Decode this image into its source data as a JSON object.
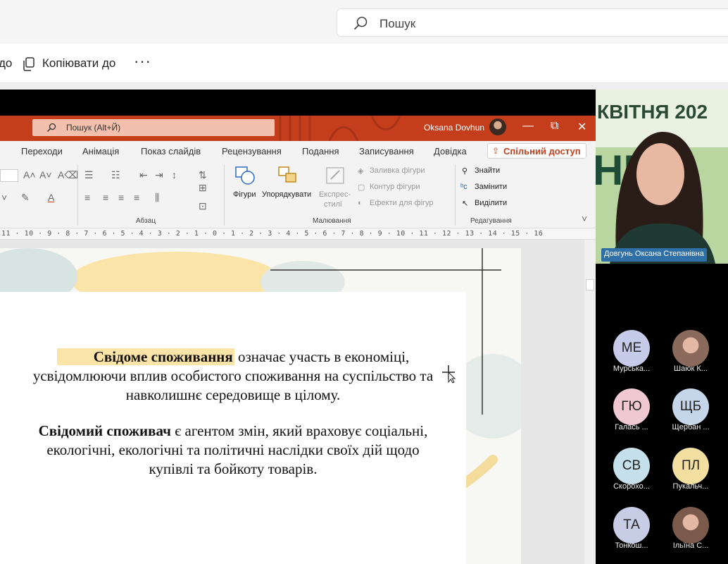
{
  "teams": {
    "search_placeholder": "Пошук",
    "cmd_left": "до",
    "copy_label": "Копіювати до",
    "more": "···"
  },
  "ppt": {
    "search": "Пошук (Alt+Й)",
    "user": "Oksana Dovhun",
    "window_controls": [
      "—",
      "⧉",
      "✕"
    ],
    "tabs": [
      "Переходи",
      "Анімація",
      "Показ слайдів",
      "Рецензування",
      "Подання",
      "Записування",
      "Довідка"
    ],
    "share": "Спільний доступ",
    "groups": {
      "paragraph": "Абзац",
      "drawing": "Малювання",
      "editing": "Редагування"
    },
    "drawing": {
      "shapes": "Фігури",
      "arrange": "Упорядкувати",
      "express1": "Експрес-",
      "express2": "стилі",
      "fill": "Заливка фігури",
      "outline": "Контур фігури",
      "effects": "Ефекти для фігур"
    },
    "editing": {
      "find": "Знайти",
      "replace": "Замінити",
      "select": "Виділити"
    },
    "ruler": "11 · 10 · 9 · 8 · 7 · 6 · 5 · 4 · 3 · 2 · 1 · 0 · 1 · 2 · 3 · 4 · 5 · 6 · 7 · 8 · 9 · 10 · 11 · 12 · 13 · 14 · 15 · 16"
  },
  "slide": {
    "p1_bold": "Свідоме споживання",
    "p1_rest": " означає участь в економіці,",
    "p1_line2": "усвідомлюючи вплив особистого споживання на суспільство та",
    "p1_line3": "навколишнє середовище в цілому.",
    "p2_bold": "Свідомий споживач",
    "p2_rest": " є агентом змін, який враховує соціальні,",
    "p2_line2": "екологічні, екологічні та політичні наслідки своїх дій щодо",
    "p2_line3": "купівлі та бойкоту товарів."
  },
  "speaker": {
    "bg_text1": "КВІТНЯ 202",
    "bg_text2": "НІВЕ",
    "name": "Довгунь Оксана Степанівна"
  },
  "participants": [
    {
      "initials": "МЕ",
      "name": "Мурська...",
      "color": "#c5cbe8"
    },
    {
      "initials": "",
      "name": "Шаюк К...",
      "color": "#8a6a5a"
    },
    {
      "initials": "ГЮ",
      "name": "Галась ...",
      "color": "#f0c8d4"
    },
    {
      "initials": "ЩБ",
      "name": "Щербан ...",
      "color": "#c5d6ea"
    },
    {
      "initials": "СВ",
      "name": "Скорохо...",
      "color": "#c5e0ea"
    },
    {
      "initials": "ПЛ",
      "name": "Пукальч...",
      "color": "#f3e0a0"
    },
    {
      "initials": "ТА",
      "name": "Тонкош...",
      "color": "#c8cde6"
    },
    {
      "initials": "",
      "name": "Ільїна С...",
      "color": "#7a5a4a"
    }
  ]
}
